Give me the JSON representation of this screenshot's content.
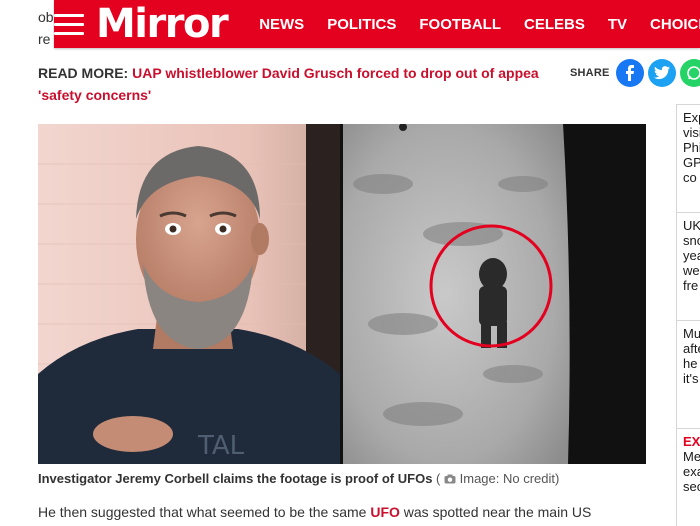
{
  "background_text": {
    "line1": "ob",
    "line2": "re"
  },
  "header": {
    "logo": "Mirror",
    "brand_color": "#e4001f",
    "nav": [
      "NEWS",
      "POLITICS",
      "FOOTBALL",
      "CELEBS",
      "TV",
      "CHOICE"
    ]
  },
  "read_more": {
    "label": "READ MORE:",
    "link_text": "UAP whistleblower David Grusch forced to drop out of appea",
    "link_text_line2": "'safety concerns'"
  },
  "share": {
    "label": "SHARE",
    "icons": [
      "facebook-icon",
      "twitter-icon",
      "whatsapp-icon"
    ]
  },
  "sidebar": {
    "cards": [
      {
        "lines": [
          "Exp",
          "visi",
          "Phi",
          "GP",
          "co"
        ]
      },
      {
        "lines": [
          "UK",
          "sno",
          "yea",
          "we",
          "fre"
        ]
      },
      {
        "lines": [
          "Mu",
          "afte",
          "he",
          "it's"
        ]
      },
      {
        "tag": "EX",
        "lines": [
          "Me",
          "exa",
          "sec"
        ]
      }
    ]
  },
  "image": {
    "alt": "Investigator Jeremy Corbell and footage"
  },
  "caption": {
    "text": "Investigator Jeremy Corbell claims the footage is proof of UFOs",
    "credit": "Image: No credit",
    "open": "(",
    "close": ")"
  },
  "body": {
    "before_link": "He then suggested that what seemed to be the same ",
    "link": "UFO",
    "after_link": " was spotted near the main US"
  }
}
